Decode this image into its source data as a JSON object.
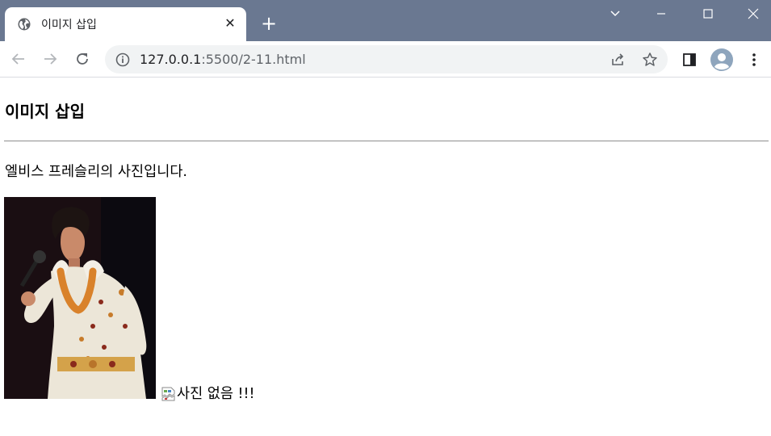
{
  "browser": {
    "tab": {
      "title": "이미지 삽입",
      "favicon": "globe-icon",
      "close_label": "✕"
    },
    "new_tab_label": "+",
    "url_host": "127.0.0.1",
    "url_rest": ":5500/2-11.html",
    "colors": {
      "titlebar": "#6a7891",
      "tab_active": "#ffffff",
      "omnibox": "#f1f3f4"
    }
  },
  "page": {
    "heading": "이미지 삽입",
    "paragraph": "엘비스 프레슬리의 사진입니다.",
    "image_alt_broken": "사진 없음 !!!"
  }
}
